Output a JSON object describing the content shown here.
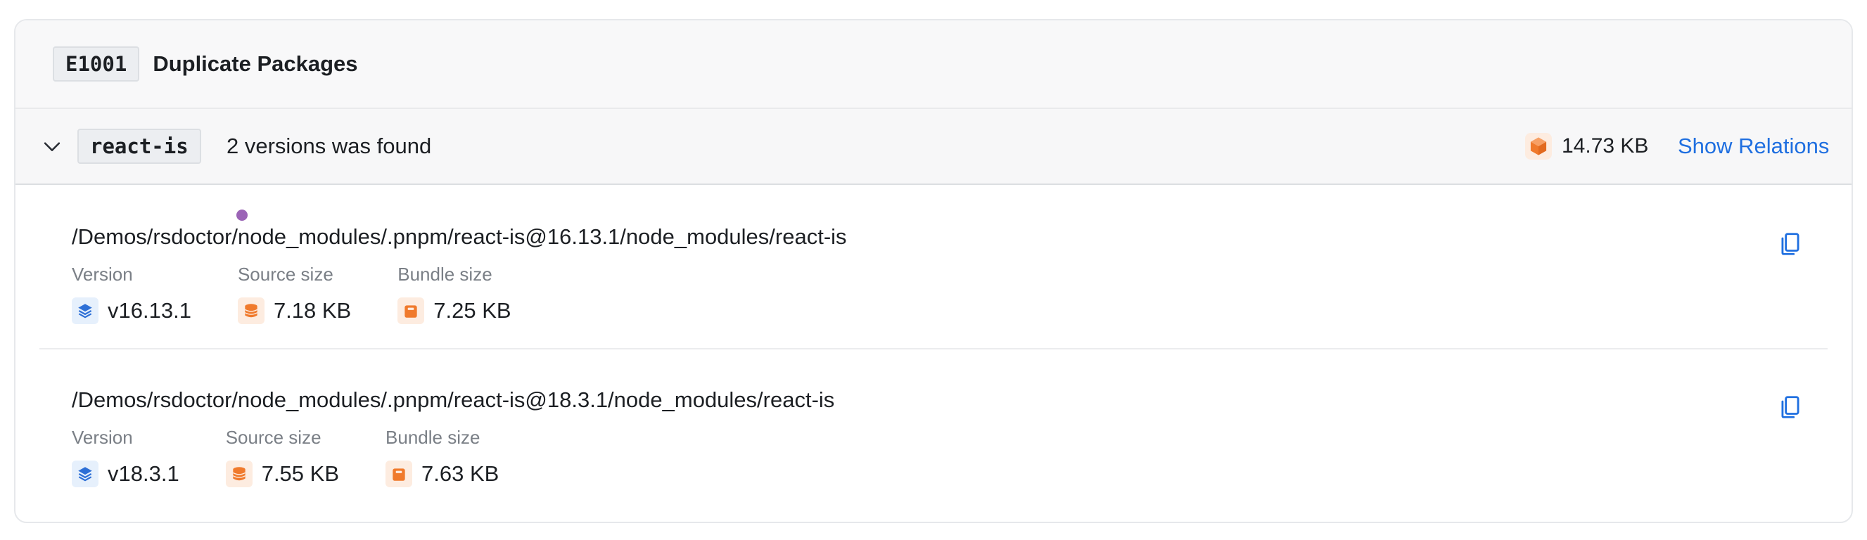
{
  "rule": {
    "code": "E1001",
    "title": "Duplicate Packages"
  },
  "package": {
    "name": "react-is",
    "summary": "2 versions was found",
    "total_size": "14.73 KB",
    "relations_label": "Show Relations"
  },
  "labels": {
    "version": "Version",
    "source_size": "Source size",
    "bundle_size": "Bundle size"
  },
  "versions": [
    {
      "path": "/Demos/rsdoctor/node_modules/.pnpm/react-is@16.13.1/node_modules/react-is",
      "version": "v16.13.1",
      "source_size": "7.18 KB",
      "bundle_size": "7.25 KB"
    },
    {
      "path": "/Demos/rsdoctor/node_modules/.pnpm/react-is@18.3.1/node_modules/react-is",
      "version": "v18.3.1",
      "source_size": "7.55 KB",
      "bundle_size": "7.63 KB"
    }
  ],
  "icons": [
    "chevron-down-icon",
    "package-cube-icon",
    "copy-icon",
    "layers-icon",
    "database-icon",
    "bundle-icon"
  ],
  "colors": {
    "accent": "#1f6fe0",
    "orange": "#f07a2c",
    "blue": "#2d6fd6",
    "dot": "#9b64b6"
  }
}
